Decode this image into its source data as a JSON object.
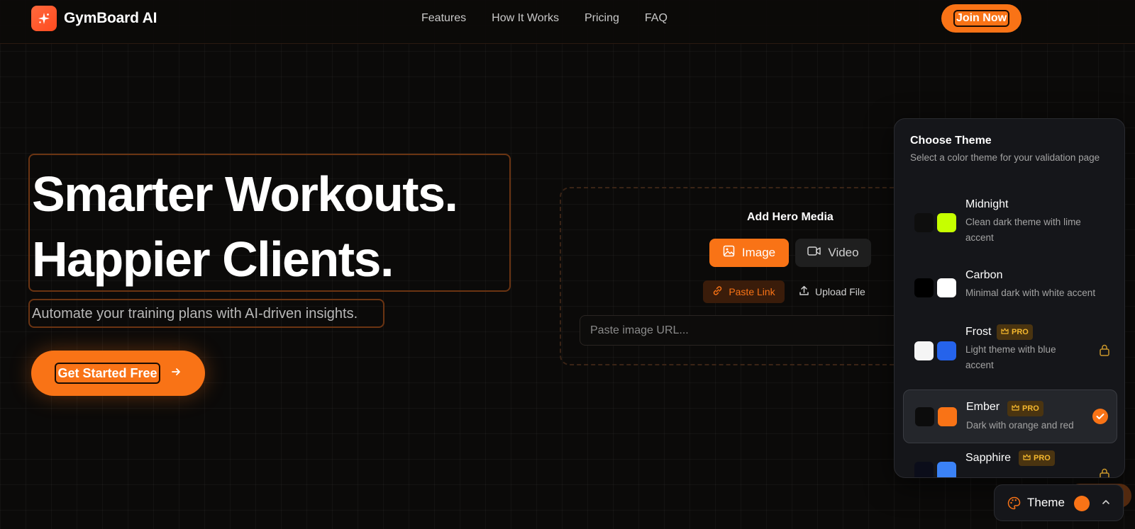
{
  "nav": {
    "brand": "GymBoard AI",
    "links": [
      "Features",
      "How It Works",
      "Pricing",
      "FAQ"
    ],
    "join_label": "Join Now"
  },
  "hero": {
    "headline_line1": "Smarter Workouts.",
    "headline_line2": "Happier Clients.",
    "subheadline": "Automate your training plans with AI-driven insights.",
    "cta_label": "Get Started Free"
  },
  "media": {
    "title": "Add Hero Media",
    "image_label": "Image",
    "video_label": "Video",
    "paste_link_label": "Paste Link",
    "upload_file_label": "Upload File",
    "url_placeholder": "Paste image URL..."
  },
  "theme_panel": {
    "title": "Choose Theme",
    "description": "Select a color theme for your validation page",
    "pro_label": "PRO",
    "themes": [
      {
        "name": "Midnight",
        "description": "Clean dark theme with lime accent",
        "swatch_base": "#0e0e0e",
        "swatch_accent": "#c6ff00",
        "pro": false,
        "locked": false,
        "selected": false
      },
      {
        "name": "Carbon",
        "description": "Minimal dark with white accent",
        "swatch_base": "#000000",
        "swatch_accent": "#ffffff",
        "pro": false,
        "locked": false,
        "selected": false
      },
      {
        "name": "Frost",
        "description": "Light theme with blue accent",
        "swatch_base": "#f5f5f5",
        "swatch_accent": "#2563eb",
        "pro": true,
        "locked": true,
        "selected": false
      },
      {
        "name": "Ember",
        "description": "Dark with orange and red",
        "swatch_base": "#0c0c0c",
        "swatch_accent": "#f97316",
        "pro": true,
        "locked": false,
        "selected": true
      },
      {
        "name": "Sapphire",
        "description": "",
        "swatch_base": "#0b0d1a",
        "swatch_accent": "#3b82f6",
        "pro": true,
        "locked": true,
        "selected": false
      }
    ]
  },
  "theme_toggle": {
    "label": "Theme",
    "current_color": "#f97316"
  },
  "colors": {
    "accent": "#f97316",
    "background": "#0b0a09",
    "panel": "#15161a",
    "pro_text": "#f5b82e"
  }
}
